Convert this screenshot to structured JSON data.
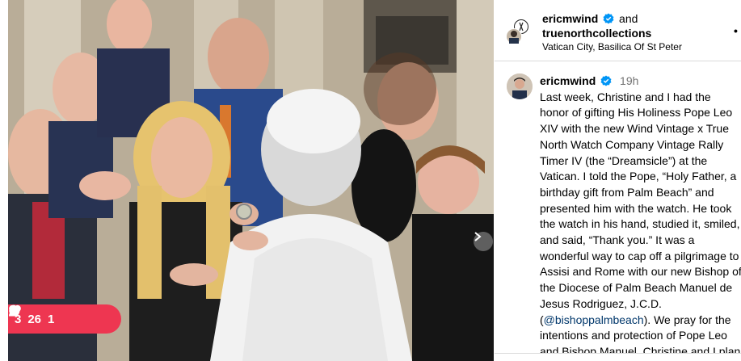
{
  "post": {
    "author1": "ericmwind",
    "joiner": "and",
    "author2": "truenorthcollections",
    "location": "Vatican City, Basilica Of St Peter",
    "more_icon": "more-dots-icon",
    "verified_color": "#0095f6"
  },
  "caption": {
    "username": "ericmwind",
    "time": "19h",
    "text_before": "Last week, Christine and I had the honor of gifting His Holiness Pope Leo XIV with the new Wind Vintage x True North Watch Company Vintage Rally Timer IV (the “Dreamsicle”) at the Vatican. I told the Pope, “Holy Father, a birthday gift from Palm Beach” and presented him with the watch. He took the watch in his hand, studied it, smiled, and said, “Thank you.” It was a wonderful way to cap off a pilgrimage to Assisi and Rome with our new Bishop of the Diocese of Palm Beach Manuel de Jesus Rodriguez, J.C.D. (",
    "mention": "@bishoppalmbeach",
    "text_after": "). We pray for the intentions and protection of Pope Leo and Bishop Manuel. Christine and I plan to dedicate a large portion of our"
  },
  "notifications": {
    "comments": "3",
    "likes": "26",
    "follows": "1",
    "color": "#ee3651"
  },
  "carousel": {
    "next_icon": "chevron-right-icon"
  }
}
